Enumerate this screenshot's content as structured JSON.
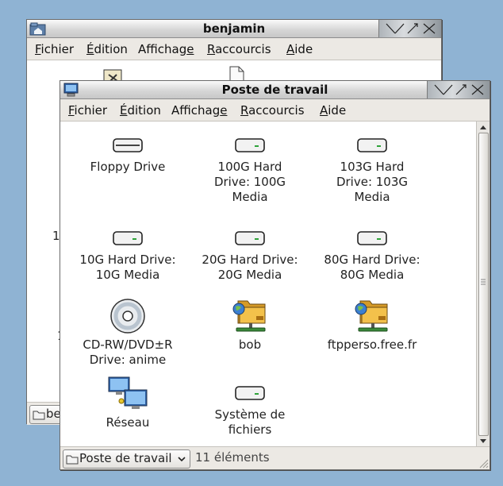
{
  "back_window": {
    "title": "benjamin",
    "menu": [
      "Fichier",
      "Édition",
      "Affichage",
      "Raccourcis",
      "Aide"
    ],
    "partial_labels": [
      "1",
      "1"
    ],
    "location_text": "be"
  },
  "front_window": {
    "title": "Poste de travail",
    "menu": [
      "Fichier",
      "Édition",
      "Affichage",
      "Raccourcis",
      "Aide"
    ],
    "items": [
      {
        "label": "Floppy Drive",
        "icon": "drive-icon"
      },
      {
        "label": "100G Hard\nDrive: 100G\nMedia",
        "icon": "drive-icon"
      },
      {
        "label": "103G Hard\nDrive: 103G\nMedia",
        "icon": "drive-icon"
      },
      {
        "label": "10G Hard Drive:\n10G Media",
        "icon": "drive-icon"
      },
      {
        "label": "20G Hard Drive:\n20G Media",
        "icon": "drive-icon"
      },
      {
        "label": "80G Hard Drive:\n80G Media",
        "icon": "drive-icon"
      },
      {
        "label": "CD-RW/DVD±R\nDrive: anime",
        "icon": "cdrom-icon"
      },
      {
        "label": "bob",
        "icon": "network-folder-icon"
      },
      {
        "label": "ftpperso.free.fr",
        "icon": "network-folder-icon"
      },
      {
        "label": "Réseau",
        "icon": "network-icon"
      },
      {
        "label": "Système de\nfichiers",
        "icon": "drive-icon"
      }
    ],
    "location": "Poste de travail",
    "status": "11 éléments"
  }
}
